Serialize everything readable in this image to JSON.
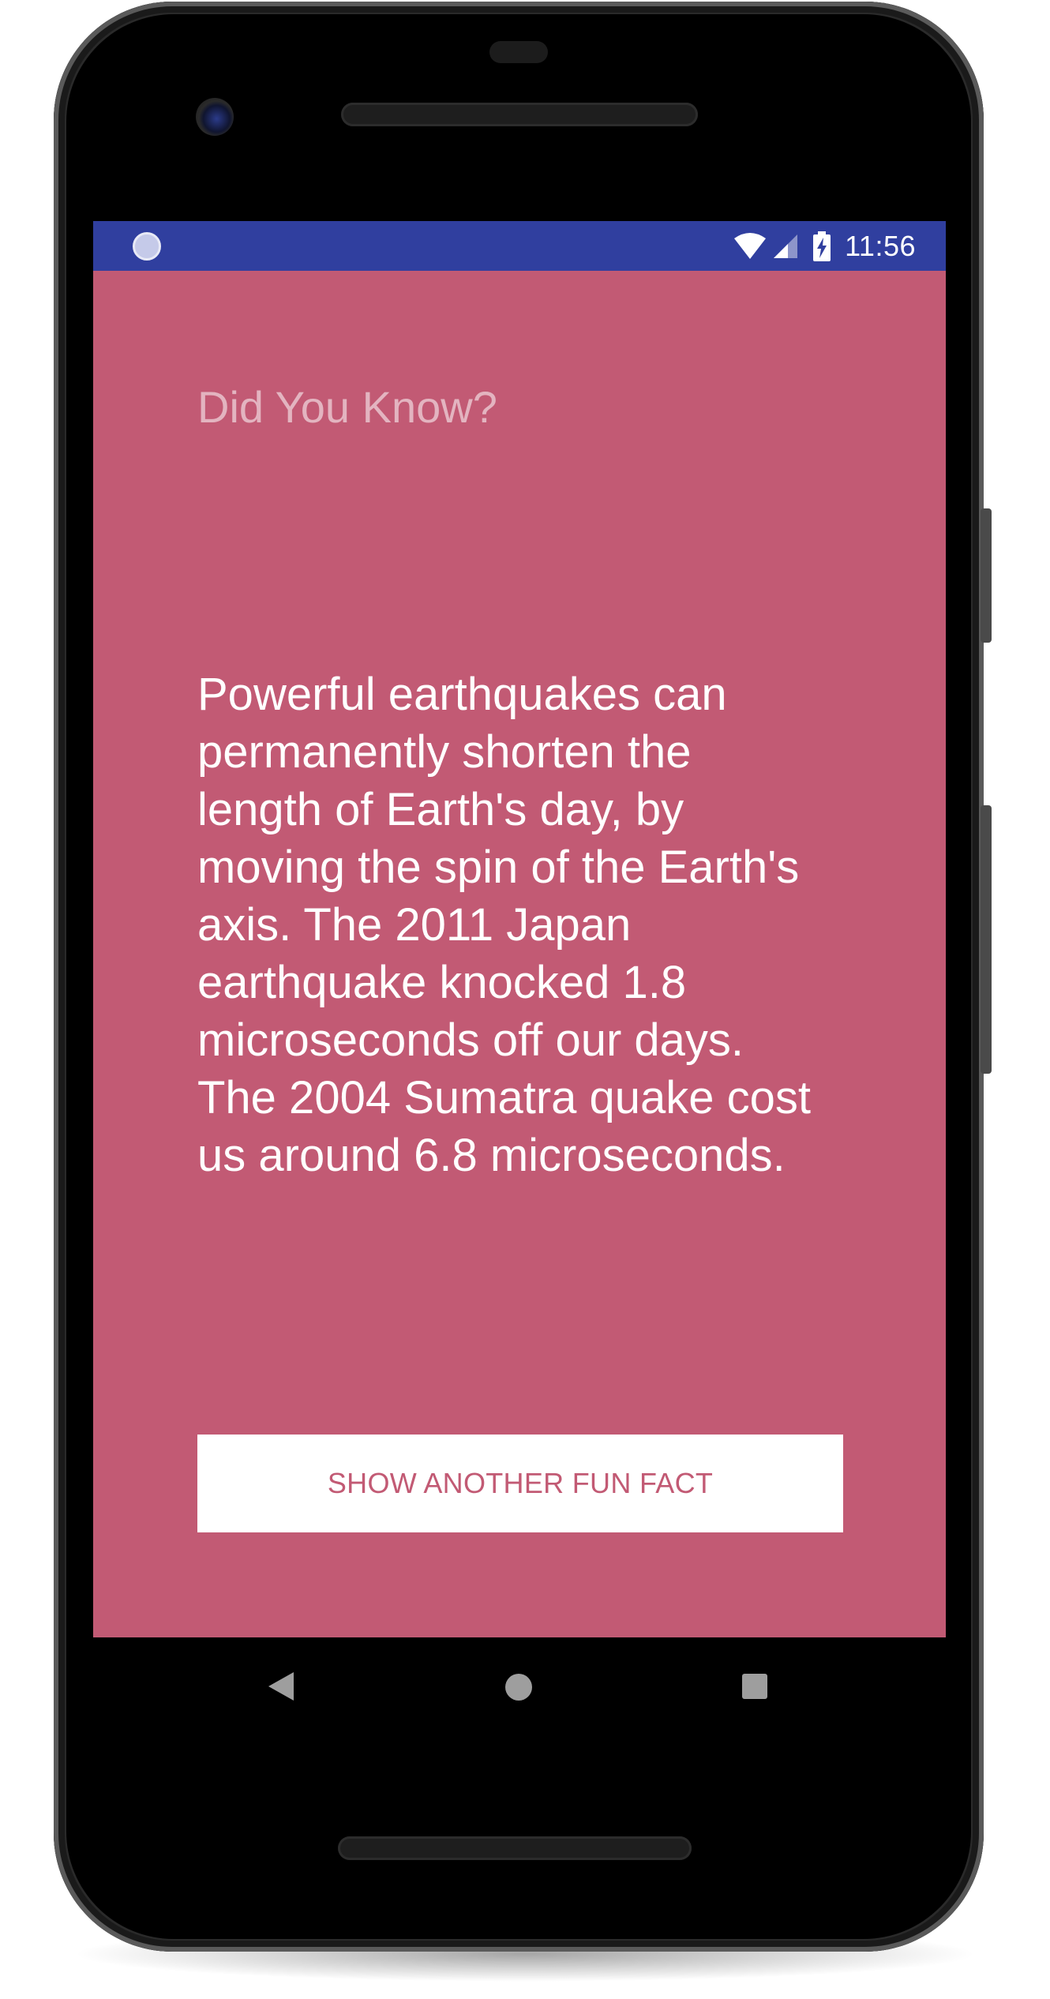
{
  "status_bar": {
    "time": "11:56",
    "background_color": "#303f9f",
    "icons": [
      "notification-icon",
      "wifi-icon",
      "cell-signal-icon",
      "battery-charging-icon"
    ]
  },
  "app": {
    "title": "Did You Know?",
    "fact": "Powerful earthquakes can permanently shorten the length of Earth's day, by moving the spin of the Earth's axis. The 2011 Japan earthquake knocked 1.8 microseconds off our days. The 2004 Sumatra quake cost us around 6.8 microseconds.",
    "button_label": "SHOW ANOTHER FUN FACT",
    "background_color": "#c25a74",
    "button_text_color": "#c25a74"
  },
  "nav_bar": {
    "icons": [
      "back-icon",
      "home-icon",
      "recents-icon"
    ]
  }
}
